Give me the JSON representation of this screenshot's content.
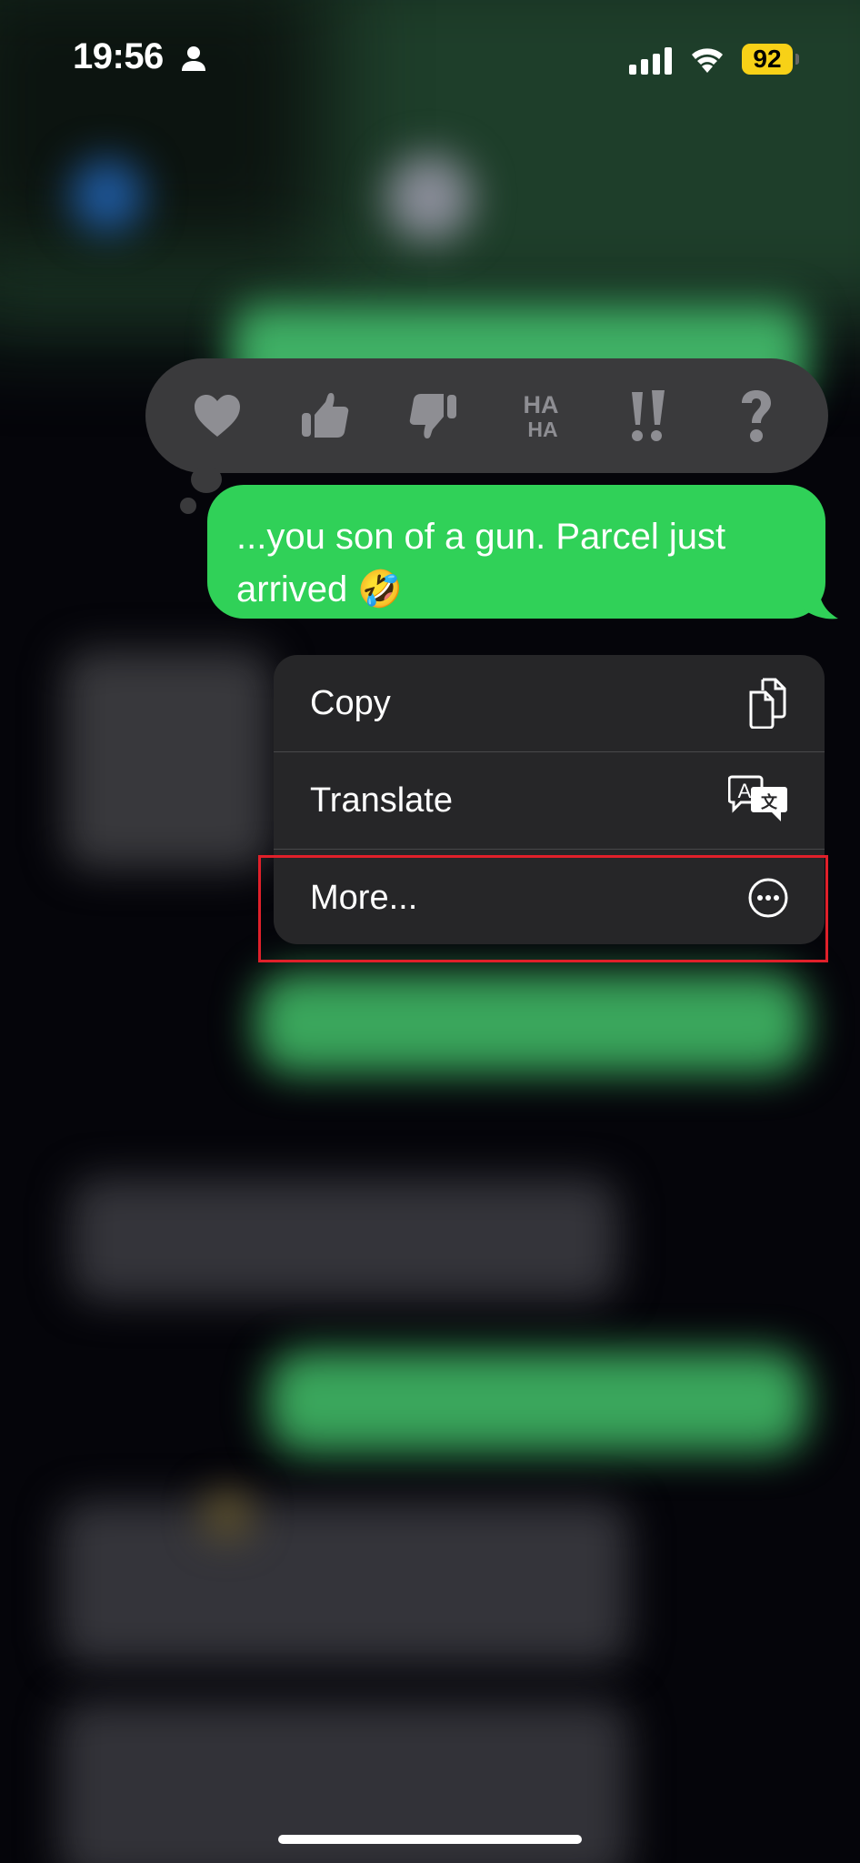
{
  "status_bar": {
    "time": "19:56",
    "battery": "92",
    "icons": [
      "person-icon",
      "cellular-signal-icon",
      "wifi-icon",
      "battery-icon"
    ]
  },
  "reactions": [
    {
      "name": "heart",
      "icon": "heart-icon"
    },
    {
      "name": "thumbs-up",
      "icon": "thumbs-up-icon"
    },
    {
      "name": "thumbs-down",
      "icon": "thumbs-down-icon"
    },
    {
      "name": "haha",
      "label": "HA HA",
      "icon": "haha-icon"
    },
    {
      "name": "exclamation",
      "label": "!!",
      "icon": "double-exclamation-icon"
    },
    {
      "name": "question",
      "label": "?",
      "icon": "question-icon"
    }
  ],
  "message": {
    "text": "...you son of a gun. Parcel just arrived 🤣",
    "color": "#30d158"
  },
  "context_menu": {
    "items": [
      {
        "label": "Copy",
        "icon": "copy-icon"
      },
      {
        "label": "Translate",
        "icon": "translate-icon"
      },
      {
        "label": "More...",
        "icon": "more-ellipsis-circle-icon"
      }
    ]
  },
  "highlight_color": "#e0202a",
  "accent": {
    "battery": "#f7d117",
    "menu_bg": "#262628",
    "reaction_bg": "#3a3a3c"
  }
}
